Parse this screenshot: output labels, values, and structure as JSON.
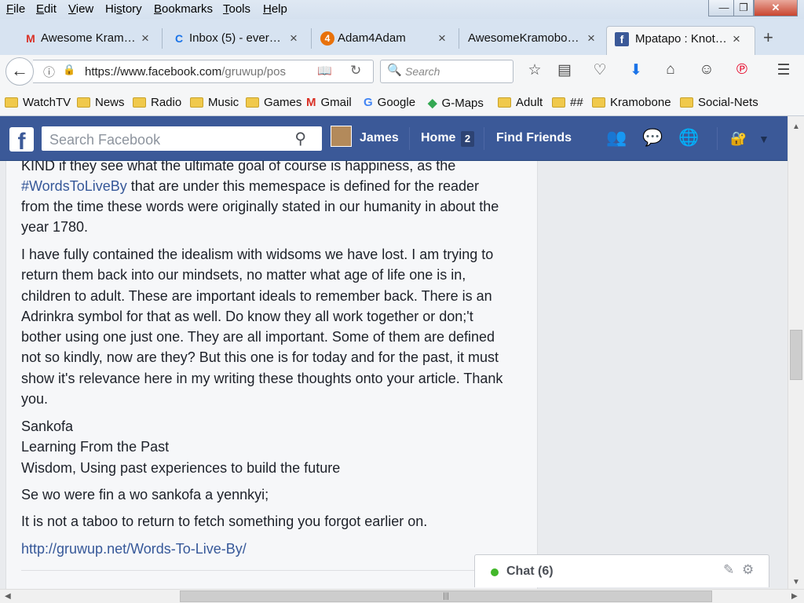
{
  "menu": {
    "file": "ile",
    "file_key": "F",
    "edit": "dit",
    "edit_key": "E",
    "view": "iew",
    "view_key": "V",
    "history_pre": "Hi",
    "history_key": "s",
    "history_post": "tory",
    "bookmarks_key": "B",
    "bookmarks": "ookmarks",
    "tools_key": "T",
    "tools": "ools",
    "help_key": "H",
    "help": "elp"
  },
  "window_controls": {
    "minimize": "—",
    "restore": "❐",
    "close": "✕"
  },
  "tabs": [
    {
      "label": "Awesome Kram…",
      "icon": "gmail-icon",
      "glyph": "M",
      "color": "#d93025",
      "close": "×"
    },
    {
      "label": "Inbox (5) - ever…",
      "icon": "loading-icon",
      "glyph": "C",
      "color": "#1a73e8",
      "close": "×"
    },
    {
      "label": "Adam4Adam",
      "icon": "adam4adam-icon",
      "glyph": "4",
      "color": "#e8710a",
      "close": "×"
    },
    {
      "label": "AwesomeKramobo…",
      "icon": "none",
      "glyph": "",
      "color": "#000000",
      "close": "×"
    },
    {
      "label": "Mpatapo : Knot…",
      "icon": "facebook-icon",
      "glyph": "f",
      "color": "#3b5998",
      "close": "×"
    }
  ],
  "new_tab": "+",
  "nav": {
    "url_host": "https://www.facebook.com",
    "url_path": "/gruwup/pos",
    "search_placeholder": "Search"
  },
  "bookmarks": [
    {
      "label": "WatchTV",
      "type": "folder"
    },
    {
      "label": "News",
      "type": "folder"
    },
    {
      "label": "Radio",
      "type": "folder"
    },
    {
      "label": "Music",
      "type": "folder"
    },
    {
      "label": "Games",
      "type": "folder"
    },
    {
      "label": "Gmail",
      "type": "gmail"
    },
    {
      "label": "Google",
      "type": "google"
    },
    {
      "label": "G-Maps",
      "type": "maps"
    },
    {
      "label": "Adult",
      "type": "folder"
    },
    {
      "label": "##",
      "type": "folder"
    },
    {
      "label": "Kramobone",
      "type": "folder"
    },
    {
      "label": "Social-Nets",
      "type": "folder"
    }
  ],
  "facebook": {
    "search_placeholder": "Search Facebook",
    "user_name": "James",
    "home_label": "Home",
    "home_count": "2",
    "find_friends": "Find Friends"
  },
  "post": {
    "line0": "KIND if they see what the ultimate goal of course is happiness, as the",
    "hashtag": "#WordsToLiveBy",
    "line1_rest": " that are under this memespace is defined for the reader",
    "line2": "from the time these words were originally stated in our humanity in about the",
    "line3": "year 1780.",
    "para2": [
      "I have fully contained the idealism with widsoms we have lost. I am trying to",
      "return them back into our mindsets, no matter what age of life one is in,",
      "children to adult. These are important ideals to remember back. There is an",
      "Adrinkra symbol for that as well. Do know they all work together or don;'t",
      "bother using one just one. They are all important. Some of them are defined",
      "not so kindly, now are they? But this one is for today and for the past, it must",
      "show it's relevance here in my writing these thoughts onto your article. Thank",
      "you."
    ],
    "para3": [
      "Sankofa",
      "Learning From the Past",
      "Wisdom, Using past experiences to build the future"
    ],
    "para4": "Se wo were fin a wo sankofa a yennkyi;",
    "para5": "It is not a taboo to return to fetch something you forgot earlier on.",
    "link": "http://gruwup.net/Words-To-Live-By/"
  },
  "chat": {
    "label": "Chat (6)",
    "status_color": "#42b72a"
  },
  "colors": {
    "facebook_blue": "#3b5998",
    "link": "#365899",
    "page_bg": "#e9ebee"
  }
}
